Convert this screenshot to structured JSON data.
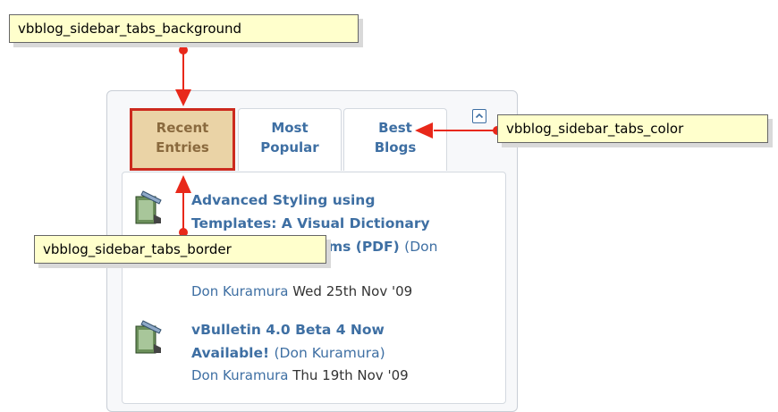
{
  "sidebar": {
    "tabs": [
      {
        "line1": "Recent",
        "line2": "Entries"
      },
      {
        "line1": "Most",
        "line2": "Popular"
      },
      {
        "line1": "Best",
        "line2": "Blogs"
      }
    ],
    "collapse_icon": "collapse-up-icon",
    "entries": [
      {
        "title_lines": [
          "Advanced Styling using",
          "Templates: A Visual Dictionary",
          "for vBulletin Forums (PDF)"
        ],
        "title_author": "(Don",
        "meta_user": "Don Kuramura",
        "meta_date": "Wed 25th Nov '09"
      },
      {
        "title_lines": [
          "vBulletin 4.0 Beta 4 Now",
          "Available!"
        ],
        "title_author": "(Don Kuramura)",
        "meta_user": "Don Kuramura",
        "meta_date": "Thu 19th Nov '09"
      }
    ],
    "entry_icon": "blog-entry-icon"
  },
  "callouts": {
    "background": "vbblog_sidebar_tabs_background",
    "color": "vbblog_sidebar_tabs_color",
    "border": "vbblog_sidebar_tabs_border"
  },
  "colors": {
    "link": "#3e6fa3",
    "highlight": "#cc2a1e",
    "callout_bg": "#ffffcc",
    "active_tab_bg": "#ead3a6"
  }
}
